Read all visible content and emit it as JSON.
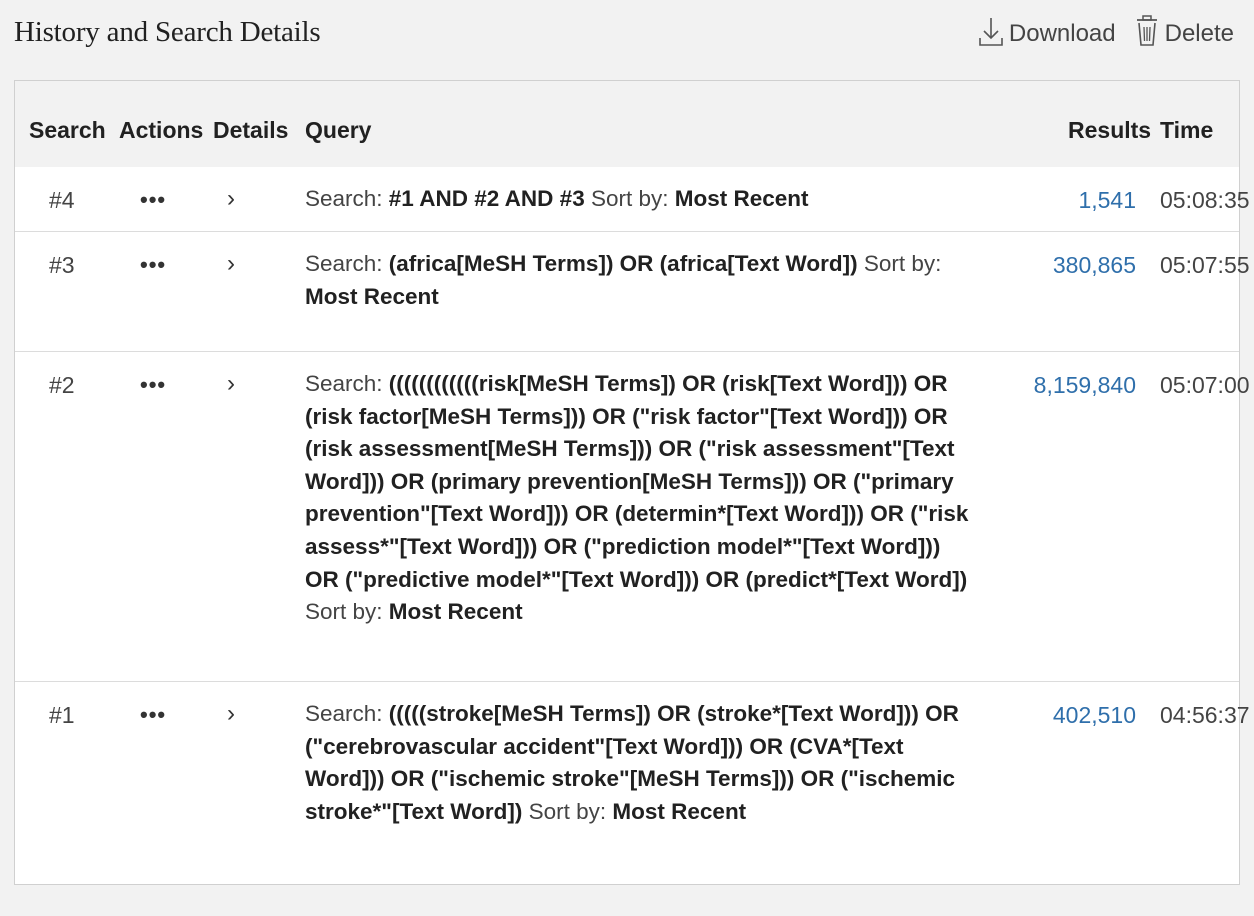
{
  "header": {
    "title": "History and Search Details",
    "download_label": "Download",
    "delete_label": "Delete"
  },
  "columns": {
    "search": "Search",
    "actions": "Actions",
    "details": "Details",
    "query": "Query",
    "results": "Results",
    "time": "Time"
  },
  "rows": [
    {
      "number": "#4",
      "actions_icon": "•••",
      "details_icon": "›",
      "query_segments": [
        {
          "text": "Search: ",
          "bold": false
        },
        {
          "text": "#1 AND #2 AND #3",
          "bold": true
        },
        {
          "text": " Sort by: ",
          "bold": false
        },
        {
          "text": "Most Recent",
          "bold": true
        }
      ],
      "results": "1,541",
      "time": "05:08:35"
    },
    {
      "number": "#3",
      "actions_icon": "•••",
      "details_icon": "›",
      "query_segments": [
        {
          "text": "Search: ",
          "bold": false
        },
        {
          "text": "(africa[MeSH Terms]) OR (africa[Text Word])",
          "bold": true
        },
        {
          "text": " Sort by: ",
          "bold": false
        },
        {
          "text": "Most Recent",
          "bold": true
        }
      ],
      "results": "380,865",
      "time": "05:07:55"
    },
    {
      "number": "#2",
      "actions_icon": "•••",
      "details_icon": "›",
      "query_segments": [
        {
          "text": "Search: ",
          "bold": false
        },
        {
          "text": "((((((((((((risk[MeSH Terms]) OR (risk[Text Word])) OR (risk factor[MeSH Terms])) OR (\"risk factor\"[Text Word])) OR (risk assessment[MeSH Terms])) OR (\"risk assessment\"[Text Word])) OR (primary prevention[MeSH Terms])) OR (\"primary prevention\"[Text Word])) OR (determin*[Text Word])) OR (\"risk assess*\"[Text Word])) OR (\"prediction model*\"[Text Word])) OR (\"predictive model*\"[Text Word])) OR (predict*[Text Word])",
          "bold": true
        },
        {
          "text": " Sort by: ",
          "bold": false
        },
        {
          "text": "Most Recent",
          "bold": true
        }
      ],
      "results": "8,159,840",
      "time": "05:07:00"
    },
    {
      "number": "#1",
      "actions_icon": "•••",
      "details_icon": "›",
      "query_segments": [
        {
          "text": "Search: ",
          "bold": false
        },
        {
          "text": "(((((stroke[MeSH Terms]) OR (stroke*[Text Word])) OR (\"cerebrovascular accident\"[Text Word])) OR (CVA*[Text Word])) OR (\"ischemic stroke\"[MeSH Terms])) OR (\"ischemic stroke*\"[Text Word])",
          "bold": true
        },
        {
          "text": " Sort by: ",
          "bold": false
        },
        {
          "text": "Most Recent",
          "bold": true
        }
      ],
      "results": "402,510",
      "time": "04:56:37"
    }
  ],
  "colors": {
    "link": "#2f6fab",
    "background": "#f2f2f2",
    "table_bg": "#ffffff"
  }
}
